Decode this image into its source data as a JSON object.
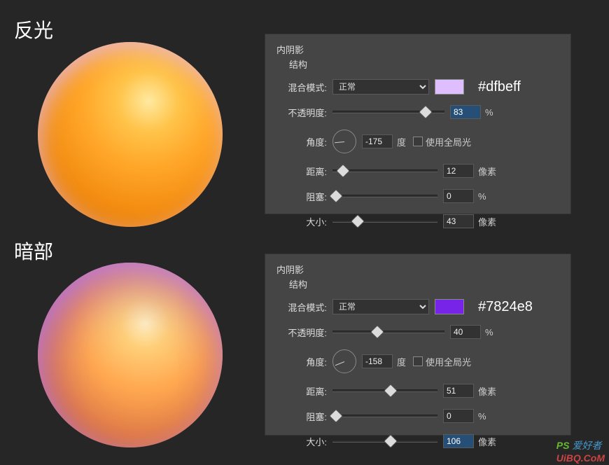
{
  "labels": {
    "reflection": "反光",
    "shadow": "暗部"
  },
  "panel1": {
    "title": "内阴影",
    "sub": "结构",
    "blend_label": "混合模式:",
    "blend_mode": "正常",
    "swatch_color": "#dfbeff",
    "hex_text": "#dfbeff",
    "opacity_label": "不透明度:",
    "opacity_value": "83",
    "opacity_unit": "%",
    "angle_label": "角度:",
    "angle_value": "-175",
    "angle_unit": "度",
    "global_light": "使用全局光",
    "distance_label": "距离:",
    "distance_value": "12",
    "distance_unit": "像素",
    "choke_label": "阻塞:",
    "choke_value": "0",
    "choke_unit": "%",
    "size_label": "大小:",
    "size_value": "43",
    "size_unit": "像素"
  },
  "panel2": {
    "title": "内阴影",
    "sub": "结构",
    "blend_label": "混合模式:",
    "blend_mode": "正常",
    "swatch_color": "#7824e8",
    "hex_text": "#7824e8",
    "opacity_label": "不透明度:",
    "opacity_value": "40",
    "opacity_unit": "%",
    "angle_label": "角度:",
    "angle_value": "-158",
    "angle_unit": "度",
    "global_light": "使用全局光",
    "distance_label": "距离:",
    "distance_value": "51",
    "distance_unit": "像素",
    "choke_label": "阻塞:",
    "choke_value": "0",
    "choke_unit": "%",
    "size_label": "大小:",
    "size_value": "106",
    "size_unit": "像素"
  },
  "watermark": {
    "ps": "PS",
    "cn": "爱好者",
    "url": "UiBQ.CoM"
  }
}
